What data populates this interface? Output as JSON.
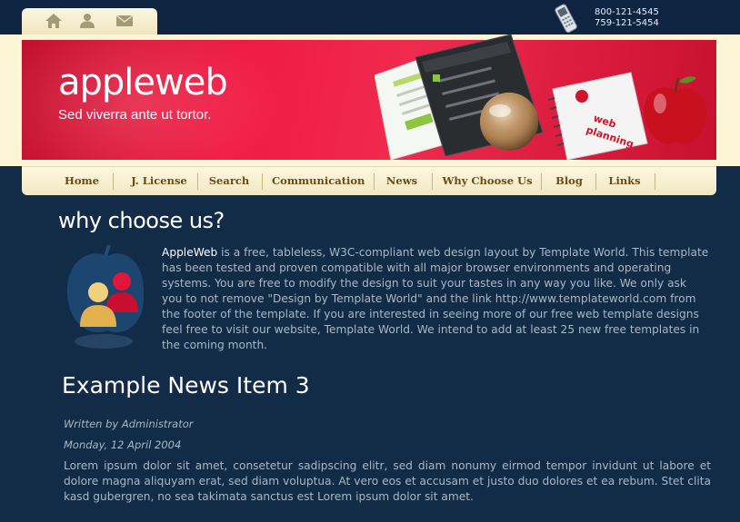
{
  "header": {
    "icons": [
      "home-icon",
      "user-icon",
      "mail-icon"
    ],
    "phone_icon": "mobile-phone-icon",
    "phones": [
      "800-121-4545",
      "759-121-5454"
    ],
    "logo": "appleweb",
    "tagline": "Sed viverra ante ut tortor."
  },
  "nav": {
    "items": [
      {
        "label": "Home"
      },
      {
        "label": "J. License"
      },
      {
        "label": "Search"
      },
      {
        "label": "Communication"
      },
      {
        "label": "News"
      },
      {
        "label": "Why Choose Us"
      },
      {
        "label": "Blog"
      },
      {
        "label": "Links"
      }
    ]
  },
  "main": {
    "section_title": "why choose us?",
    "intro_brand": "AppleWeb",
    "intro_text": " is a free, tableless, W3C-compliant web design layout by Template World. This template has been tested and proven compatible with all major browser environments and operating systems. You are free to modify the design to suit your tastes in any way you like. We only ask you to not remove \"Design by Template World\" and the link http://www.templateworld.com from the footer of the template. If you are interested in seeing more of our free web template designs feel free to visit our website, Template World. We intend to add at least 25 new free templates in the coming month.",
    "news": {
      "title": "Example News Item 3",
      "author": "Written by Administrator",
      "date": "Monday, 12 April 2004",
      "body": "Lorem ipsum dolor sit amet, consetetur sadipscing elitr, sed diam nonumy eirmod tempor invidunt ut labore et dolore magna aliquyam erat, sed diam voluptua. At vero eos et accusam et justo duo dolores et ea rebum. Stet clita kasd gubergren, no sea takimata sanctus est Lorem ipsum dolor sit amet."
    }
  },
  "art": {
    "book_label_1": "web",
    "book_label_2": "planning"
  },
  "colors": {
    "background": "#122b47",
    "header_cream": "#fcf5d6",
    "banner_red": "#ef1a44",
    "nav_text": "#6e4a16",
    "body_text": "#aab7c6"
  }
}
